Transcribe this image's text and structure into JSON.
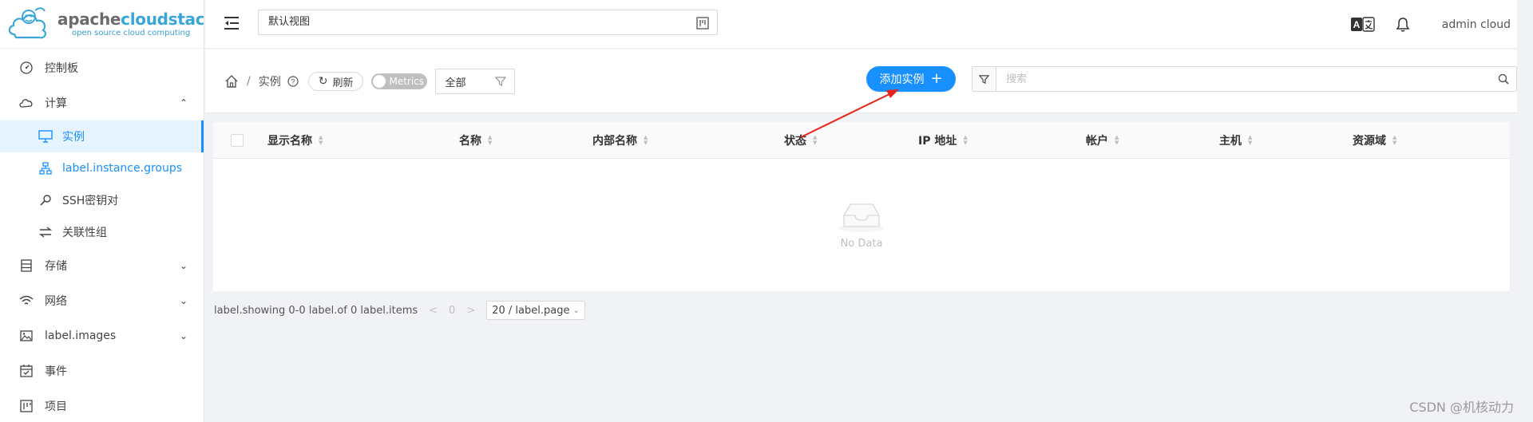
{
  "brand": {
    "name_part1": "apache",
    "name_part2": "cloudstack",
    "tagline": "open source cloud computing"
  },
  "header": {
    "view_select": "默认视图",
    "user_name": "admin cloud"
  },
  "sidebar": {
    "items": [
      {
        "label": "控制板",
        "icon": "dashboard-icon"
      },
      {
        "label": "计算",
        "icon": "cloud-icon",
        "expanded": true,
        "children": [
          {
            "label": "实例",
            "icon": "desktop-icon",
            "active": true
          },
          {
            "label": "label.instance.groups",
            "icon": "cluster-icon"
          },
          {
            "label": "SSH密钥对",
            "icon": "key-icon"
          },
          {
            "label": "关联性组",
            "icon": "swap-icon"
          }
        ]
      },
      {
        "label": "存储",
        "icon": "database-icon"
      },
      {
        "label": "网络",
        "icon": "wifi-icon"
      },
      {
        "label": "label.images",
        "icon": "picture-icon"
      },
      {
        "label": "事件",
        "icon": "schedule-icon"
      },
      {
        "label": "项目",
        "icon": "project-icon"
      }
    ]
  },
  "toolbar": {
    "breadcrumb_sep": "/",
    "breadcrumb_current": "实例",
    "refresh_label": "刷新",
    "metrics_label": "Metrics",
    "filter_select": "全部",
    "add_button": "添加实例",
    "search_placeholder": "搜索"
  },
  "table": {
    "columns": [
      "显示名称",
      "名称",
      "内部名称",
      "状态",
      "IP 地址",
      "帐户",
      "主机",
      "资源域"
    ],
    "rows": [],
    "empty_text": "No Data"
  },
  "pagination": {
    "summary": "label.showing 0-0 label.of 0 label.items",
    "current_page": "0",
    "page_size": "20 / label.page"
  },
  "watermark": "CSDN @机核动力",
  "colors": {
    "accent": "#1890ff",
    "annotation_arrow": "#e8231c"
  }
}
